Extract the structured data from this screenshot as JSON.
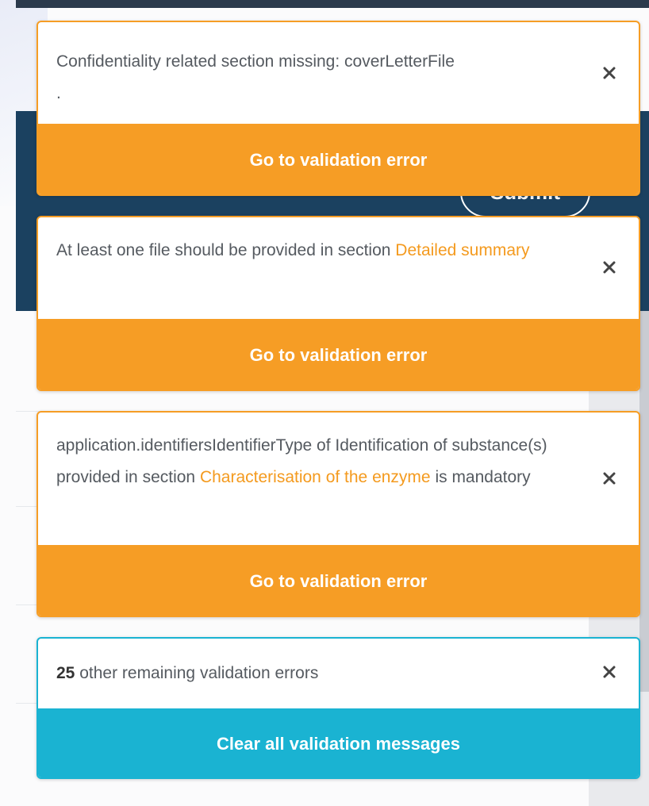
{
  "background": {
    "submit_label": "Submit"
  },
  "toasts": [
    {
      "message": "Confidentiality related section missing: coverLetterFile",
      "trailing": ".",
      "action_label": "Go to validation error"
    },
    {
      "message_prefix": "At least one file should be provided in section ",
      "link": "Detailed summary",
      "action_label": "Go to validation error"
    },
    {
      "message_prefix": "application.identifiersIdentifierType of Identification of substance(s) provided in section ",
      "link": "Characterisation of the enzyme",
      "message_suffix": " is mandatory",
      "action_label": "Go to validation error"
    },
    {
      "count": "25",
      "message": " other remaining validation errors",
      "action_label": "Clear all validation messages"
    }
  ],
  "colors": {
    "warning": "#f69d25",
    "info": "#1ab3d2",
    "header_dark": "#1b4160"
  },
  "icons": {
    "close": "close-icon"
  }
}
